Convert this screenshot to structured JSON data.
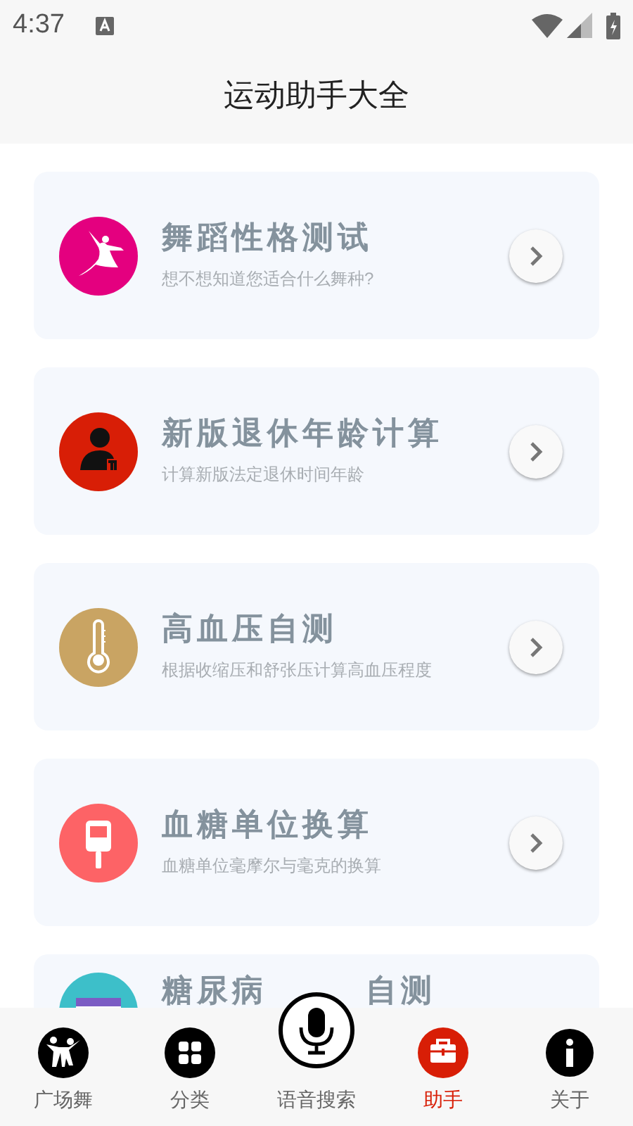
{
  "status_bar": {
    "time": "4:37"
  },
  "header": {
    "title": "运动助手大全"
  },
  "cards": [
    {
      "kind": "dancer",
      "color": "#e4007f",
      "title": "舞蹈性格测试",
      "subtitle": "想不想知道您适合什么舞种?"
    },
    {
      "kind": "elder",
      "color": "#d81e06",
      "title": "新版退休年龄计算",
      "subtitle": "计算新版法定退休时间年龄"
    },
    {
      "kind": "thermometer",
      "color": "#c9a463",
      "title": "高血压自测",
      "subtitle": "根据收缩压和舒张压计算高血压程度"
    },
    {
      "kind": "glucose",
      "color": "#fd6366",
      "title": "血糖单位换算",
      "subtitle": "血糖单位毫摩尔与毫克的换算"
    },
    {
      "kind": "calendar",
      "color": "#3dbfc9",
      "title_parts": [
        "糖尿病",
        "自测"
      ]
    }
  ],
  "nav": [
    {
      "kind": "dancers",
      "label": "广场舞",
      "selected": false
    },
    {
      "kind": "grid",
      "label": "分类",
      "selected": false
    },
    {
      "kind": "mic",
      "label": "语音搜索",
      "selected": false
    },
    {
      "kind": "toolbox",
      "label": "助手",
      "selected": true
    },
    {
      "kind": "info",
      "label": "关于",
      "selected": false
    }
  ]
}
